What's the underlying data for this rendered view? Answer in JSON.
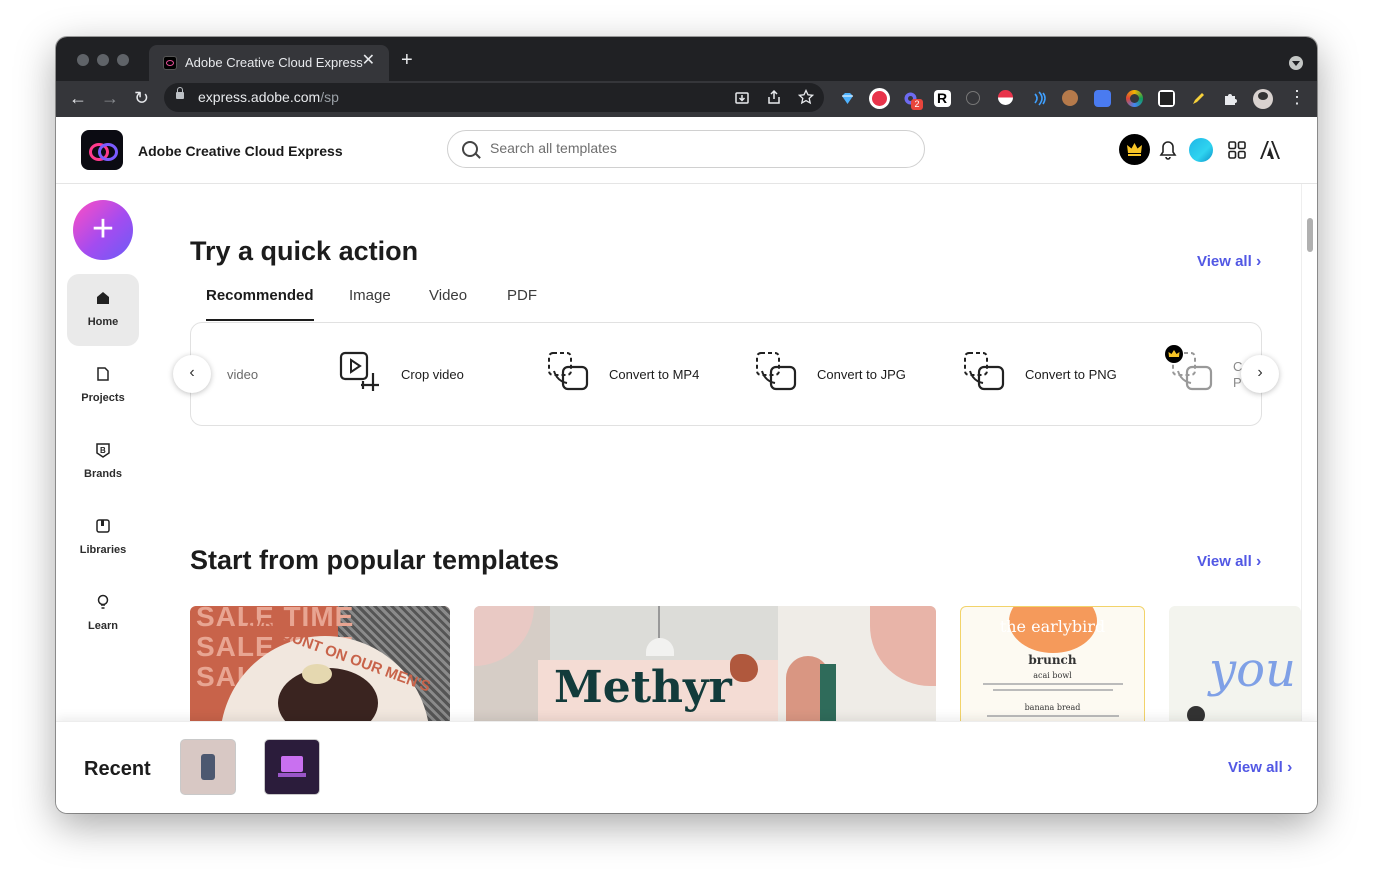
{
  "browser": {
    "tab_title": "Adobe Creative Cloud Express",
    "tab_close": "✕",
    "new_tab": "+",
    "url_host": "express.adobe.com",
    "url_path": "/sp",
    "back": "←",
    "forward": "→",
    "reload": "↻",
    "menu": "⋮",
    "badge_count": "2"
  },
  "app": {
    "name": "Adobe Creative Cloud Express",
    "search_placeholder": "Search all templates"
  },
  "rail": {
    "create": "+",
    "items": [
      {
        "label": "Home",
        "icon": "home-icon"
      },
      {
        "label": "Projects",
        "icon": "document-icon"
      },
      {
        "label": "Brands",
        "icon": "brand-icon"
      },
      {
        "label": "Libraries",
        "icon": "library-icon"
      },
      {
        "label": "Learn",
        "icon": "lightbulb-icon"
      }
    ]
  },
  "quick_actions": {
    "title": "Try a quick action",
    "view_all": "View all",
    "tabs": [
      "Recommended",
      "Image",
      "Video",
      "PDF"
    ],
    "active_tab": "Recommended",
    "items": [
      {
        "label": "video",
        "icon": "video-icon"
      },
      {
        "label": "Crop video",
        "icon": "crop-video-icon"
      },
      {
        "label": "Convert to MP4",
        "icon": "convert-icon"
      },
      {
        "label": "Convert to JPG",
        "icon": "convert-icon"
      },
      {
        "label": "Convert to PNG",
        "icon": "convert-icon"
      },
      {
        "label": "C\nP",
        "icon": "convert-premium-icon"
      }
    ],
    "prev": "‹",
    "next": "›"
  },
  "templates": {
    "title": "Start from popular templates",
    "view_all": "View all",
    "card_texts": {
      "sale": "SALE TIME",
      "discount": "DISCOUNT ON OUR MEN'S",
      "methyr": "Methyr",
      "earlybird": "the earlybird",
      "brunch": "brunch",
      "acai": "acai bowl",
      "banana": "banana bread",
      "script": "you"
    }
  },
  "recent": {
    "title": "Recent",
    "view_all": "View all"
  },
  "colors": {
    "accent": "#5258e4",
    "create_gradient_start": "#ff4ec3",
    "create_gradient_end": "#6b5cf6"
  }
}
